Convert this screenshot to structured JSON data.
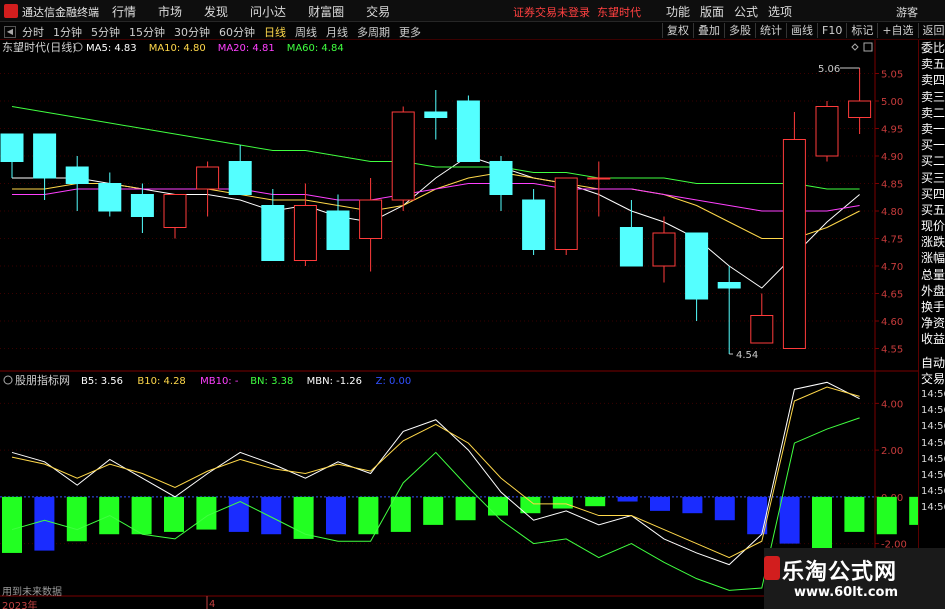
{
  "app": {
    "title": "通达信金融终端",
    "menu": [
      "行情",
      "市场",
      "发现",
      "问小达",
      "财富圈",
      "交易"
    ],
    "status": "证券交易未登录",
    "stock_tag": "东望时代",
    "menu_right": [
      "功能",
      "版面",
      "公式",
      "选项"
    ],
    "guest": "游客"
  },
  "toolbar": {
    "periods": [
      "分时",
      "1分钟",
      "5分钟",
      "15分钟",
      "30分钟",
      "60分钟",
      "日线",
      "周线",
      "月线",
      "多周期",
      "更多"
    ],
    "active": "日线",
    "right": [
      "复权",
      "叠加",
      "多股",
      "统计",
      "画线",
      "F10",
      "标记",
      "+自选",
      "返回"
    ]
  },
  "main_chart": {
    "label": "东望时代(日线)",
    "ma": [
      {
        "name": "MA5",
        "value": "4.83",
        "color": "#ffffff"
      },
      {
        "name": "MA10",
        "value": "4.80",
        "color": "#ffd84a"
      },
      {
        "name": "MA20",
        "value": "4.81",
        "color": "#ff40ff"
      },
      {
        "name": "MA60",
        "value": "4.84",
        "color": "#40ff40"
      }
    ],
    "high_label": "5.06",
    "low_label": "4.54",
    "y_ticks": [
      "5.05",
      "5.00",
      "4.95",
      "4.90",
      "4.85",
      "4.80",
      "4.75",
      "4.70",
      "4.65",
      "4.60",
      "4.55"
    ]
  },
  "indicator": {
    "label": "股朋指标网",
    "items": [
      {
        "name": "B5",
        "value": "3.56",
        "color": "#ffffff"
      },
      {
        "name": "B10",
        "value": "4.28",
        "color": "#ffd84a"
      },
      {
        "name": "MB10",
        "value": "-",
        "color": "#ff40ff"
      },
      {
        "name": "BN",
        "value": "3.38",
        "color": "#40ff40"
      },
      {
        "name": "MBN",
        "value": "-1.26",
        "color": "#ffffff"
      },
      {
        "name": "Z",
        "value": "0.00",
        "color": "#3050ff"
      }
    ],
    "y_ticks": [
      "4.00",
      "2.00",
      "0.00",
      "-2.00"
    ]
  },
  "side_panel": [
    "委比",
    "卖五",
    "卖四",
    "卖三",
    "卖二",
    "卖一",
    "买一",
    "买二",
    "买三",
    "买四",
    "买五",
    "现价",
    "涨跌",
    "涨幅",
    "总量",
    "外盘",
    "换手",
    "净资",
    "收益",
    "自动",
    "交易"
  ],
  "side_times": [
    "14:56",
    "14:56",
    "14:56",
    "14:56",
    "14:56",
    "14:56",
    "14:56",
    "14:56"
  ],
  "footer": {
    "note": "用到未来数据",
    "year": "2023年",
    "month_tick": "4"
  },
  "watermark": {
    "main": "乐淘公式网",
    "url": "www.60lt.com"
  },
  "chart_data": [
    {
      "type": "candlestick",
      "title": "东望时代(日线)",
      "ylim": [
        4.52,
        5.1
      ],
      "candles": [
        {
          "o": 4.94,
          "h": 4.94,
          "l": 4.86,
          "c": 4.89
        },
        {
          "o": 4.94,
          "h": 4.94,
          "l": 4.82,
          "c": 4.86
        },
        {
          "o": 4.88,
          "h": 4.9,
          "l": 4.8,
          "c": 4.85
        },
        {
          "o": 4.85,
          "h": 4.87,
          "l": 4.79,
          "c": 4.8
        },
        {
          "o": 4.83,
          "h": 4.85,
          "l": 4.76,
          "c": 4.79
        },
        {
          "o": 4.77,
          "h": 4.83,
          "l": 4.75,
          "c": 4.83
        },
        {
          "o": 4.84,
          "h": 4.89,
          "l": 4.79,
          "c": 4.88
        },
        {
          "o": 4.89,
          "h": 4.92,
          "l": 4.83,
          "c": 4.83
        },
        {
          "o": 4.81,
          "h": 4.84,
          "l": 4.71,
          "c": 4.71
        },
        {
          "o": 4.71,
          "h": 4.85,
          "l": 4.7,
          "c": 4.81
        },
        {
          "o": 4.8,
          "h": 4.83,
          "l": 4.73,
          "c": 4.73
        },
        {
          "o": 4.75,
          "h": 4.86,
          "l": 4.69,
          "c": 4.82
        },
        {
          "o": 4.82,
          "h": 4.99,
          "l": 4.8,
          "c": 4.98
        },
        {
          "o": 4.98,
          "h": 5.02,
          "l": 4.93,
          "c": 4.97
        },
        {
          "o": 5.0,
          "h": 5.01,
          "l": 4.89,
          "c": 4.89
        },
        {
          "o": 4.89,
          "h": 4.9,
          "l": 4.8,
          "c": 4.83
        },
        {
          "o": 4.82,
          "h": 4.84,
          "l": 4.72,
          "c": 4.73
        },
        {
          "o": 4.73,
          "h": 4.86,
          "l": 4.72,
          "c": 4.86
        },
        {
          "o": 4.86,
          "h": 4.89,
          "l": 4.79,
          "c": 4.86
        },
        {
          "o": 4.77,
          "h": 4.82,
          "l": 4.71,
          "c": 4.7
        },
        {
          "o": 4.7,
          "h": 4.79,
          "l": 4.67,
          "c": 4.76
        },
        {
          "o": 4.76,
          "h": 4.76,
          "l": 4.6,
          "c": 4.64
        },
        {
          "o": 4.67,
          "h": 4.7,
          "l": 4.54,
          "c": 4.66
        },
        {
          "o": 4.56,
          "h": 4.65,
          "l": 4.56,
          "c": 4.61
        },
        {
          "o": 4.55,
          "h": 4.98,
          "l": 4.55,
          "c": 4.93
        },
        {
          "o": 4.9,
          "h": 5.0,
          "l": 4.89,
          "c": 4.99
        },
        {
          "o": 4.97,
          "h": 5.06,
          "l": 4.94,
          "c": 5.0
        }
      ],
      "ma_series": [
        {
          "name": "MA5",
          "values": [
            4.86,
            4.86,
            4.86,
            4.85,
            4.84,
            4.83,
            4.83,
            4.82,
            4.8,
            4.81,
            4.79,
            4.78,
            4.81,
            4.86,
            4.9,
            4.88,
            4.86,
            4.85,
            4.83,
            4.8,
            4.78,
            4.75,
            4.7,
            4.66,
            4.72,
            4.78,
            4.83
          ]
        },
        {
          "name": "MA10",
          "values": [
            4.84,
            4.84,
            4.85,
            4.85,
            4.84,
            4.84,
            4.84,
            4.83,
            4.82,
            4.82,
            4.81,
            4.8,
            4.81,
            4.84,
            4.86,
            4.87,
            4.86,
            4.85,
            4.84,
            4.84,
            4.83,
            4.81,
            4.78,
            4.75,
            4.75,
            4.77,
            4.8
          ]
        },
        {
          "name": "MA20",
          "values": [
            4.83,
            4.83,
            4.84,
            4.84,
            4.84,
            4.84,
            4.84,
            4.84,
            4.83,
            4.83,
            4.82,
            4.82,
            4.83,
            4.84,
            4.85,
            4.85,
            4.85,
            4.84,
            4.84,
            4.84,
            4.83,
            4.82,
            4.81,
            4.8,
            4.8,
            4.8,
            4.81
          ]
        },
        {
          "name": "MA60",
          "values": [
            4.99,
            4.98,
            4.97,
            4.96,
            4.95,
            4.94,
            4.93,
            4.92,
            4.91,
            4.91,
            4.9,
            4.89,
            4.89,
            4.88,
            4.88,
            4.88,
            4.87,
            4.87,
            4.86,
            4.86,
            4.86,
            4.85,
            4.85,
            4.85,
            4.85,
            4.84,
            4.84
          ]
        }
      ]
    },
    {
      "type": "bar",
      "title": "股朋指标网",
      "ylim": [
        -4.2,
        5.0
      ],
      "bars": [
        -2.4,
        -2.3,
        -1.9,
        -1.6,
        -1.6,
        -1.5,
        -1.4,
        -1.5,
        -1.6,
        -1.8,
        -1.6,
        -1.6,
        -1.5,
        -1.2,
        -1.0,
        -0.8,
        -0.7,
        -0.5,
        -0.4,
        -0.2,
        -0.6,
        -0.7,
        -1.0,
        -1.6,
        -2.0,
        -2.3,
        -1.5,
        -1.6,
        -1.2
      ],
      "bar_colors": [
        "green",
        "blue",
        "green",
        "green",
        "green",
        "green",
        "green",
        "blue",
        "blue",
        "green",
        "blue",
        "green",
        "green",
        "green",
        "green",
        "green",
        "green",
        "green",
        "green",
        "blue",
        "blue",
        "blue",
        "blue",
        "blue",
        "blue",
        "green",
        "green",
        "green",
        "green"
      ],
      "series": [
        {
          "name": "B5",
          "values": [
            1.9,
            1.5,
            0.5,
            1.6,
            0.8,
            0.0,
            1.0,
            1.9,
            1.4,
            0.8,
            1.5,
            1.0,
            2.8,
            3.3,
            2.0,
            0.2,
            -1.0,
            -0.6,
            -1.2,
            -0.8,
            -1.8,
            -2.4,
            -2.9,
            -1.6,
            4.6,
            4.9,
            4.2
          ]
        },
        {
          "name": "B10",
          "values": [
            1.7,
            1.4,
            0.8,
            1.4,
            1.0,
            0.4,
            1.1,
            1.6,
            1.2,
            1.0,
            1.4,
            1.1,
            2.4,
            3.1,
            2.3,
            0.8,
            -0.3,
            -0.3,
            -0.8,
            -0.8,
            -1.4,
            -2.0,
            -2.6,
            -1.9,
            4.1,
            4.7,
            4.3
          ]
        },
        {
          "name": "BN",
          "values": [
            -1.4,
            -1.0,
            -1.4,
            -0.8,
            -1.6,
            -1.8,
            -0.8,
            -0.2,
            -0.9,
            -1.6,
            -1.9,
            -1.9,
            0.6,
            1.9,
            0.4,
            -1.0,
            -2.0,
            -1.8,
            -2.6,
            -2.0,
            -2.8,
            -3.5,
            -4.0,
            -3.9,
            2.3,
            2.9,
            3.38
          ]
        }
      ]
    }
  ]
}
